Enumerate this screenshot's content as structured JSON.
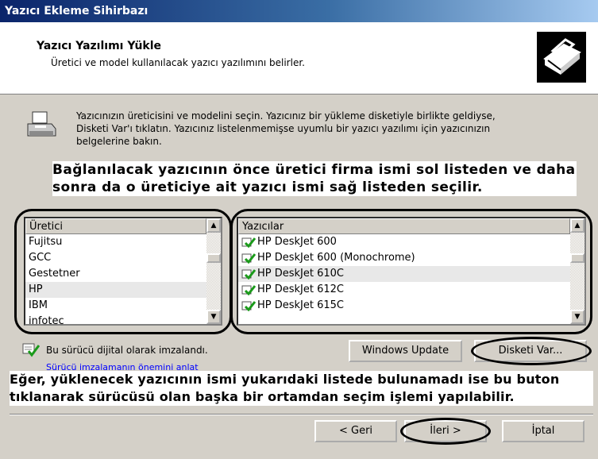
{
  "window": {
    "title": "Yazıcı Ekleme Sihirbazı"
  },
  "header": {
    "title": "Yazıcı Yazılımı Yükle",
    "subtitle": "Üretici ve model kullanılacak yazıcı yazılımını belirler."
  },
  "description": {
    "line1": "Yazıcınızın üreticisini ve modelini seçin. Yazıcınız bir yükleme disketiyle birlikte geldiyse,",
    "line2": "Disketi Var'ı tıklatın. Yazıcınız listelenmemişse uyumlu bir yazıcı yazılımı için yazıcınızın",
    "line3": "belgelerine bakın."
  },
  "annotation_top": {
    "line1": "Bağlanılacak yazıcının önce üretici firma ismi sol listeden ve daha",
    "line2": "sonra da o üreticiye ait yazıcı ismi sağ listeden seçilir."
  },
  "manufacturers": {
    "header": "Üretici",
    "items": [
      "Fujitsu",
      "GCC",
      "Gestetner",
      "HP",
      "IBM",
      "infotec"
    ],
    "selected": "HP"
  },
  "printers": {
    "header": "Yazıcılar",
    "items": [
      "HP DeskJet 600",
      "HP DeskJet 600 (Monochrome)",
      "HP DeskJet 610C",
      "HP DeskJet 612C",
      "HP DeskJet 615C"
    ],
    "selected": "HP DeskJet 610C",
    "item_icon": "signed-driver-icon"
  },
  "driver_status": {
    "signed_text": "Bu sürücü dijital olarak imzalandı.",
    "link_text": "Sürücü imzalamanın önemini anlat"
  },
  "buttons": {
    "windows_update": "Windows Update",
    "have_disk": "Disketi Var...",
    "back": "< Geri",
    "next": "İleri >",
    "cancel": "İptal"
  },
  "annotation_bottom": {
    "line1": "Eğer, yüklenecek yazıcının ismi yukarıdaki listede bulunamadı ise bu buton",
    "line2": "tıklanarak sürücüsü olan başka bir ortamdan seçim işlemi yapılabilir."
  },
  "colors": {
    "titlebar_start": "#0a246a",
    "titlebar_end": "#a6caf0",
    "dialog_bg": "#d4d0c8",
    "selection": "#e8e8e8"
  }
}
